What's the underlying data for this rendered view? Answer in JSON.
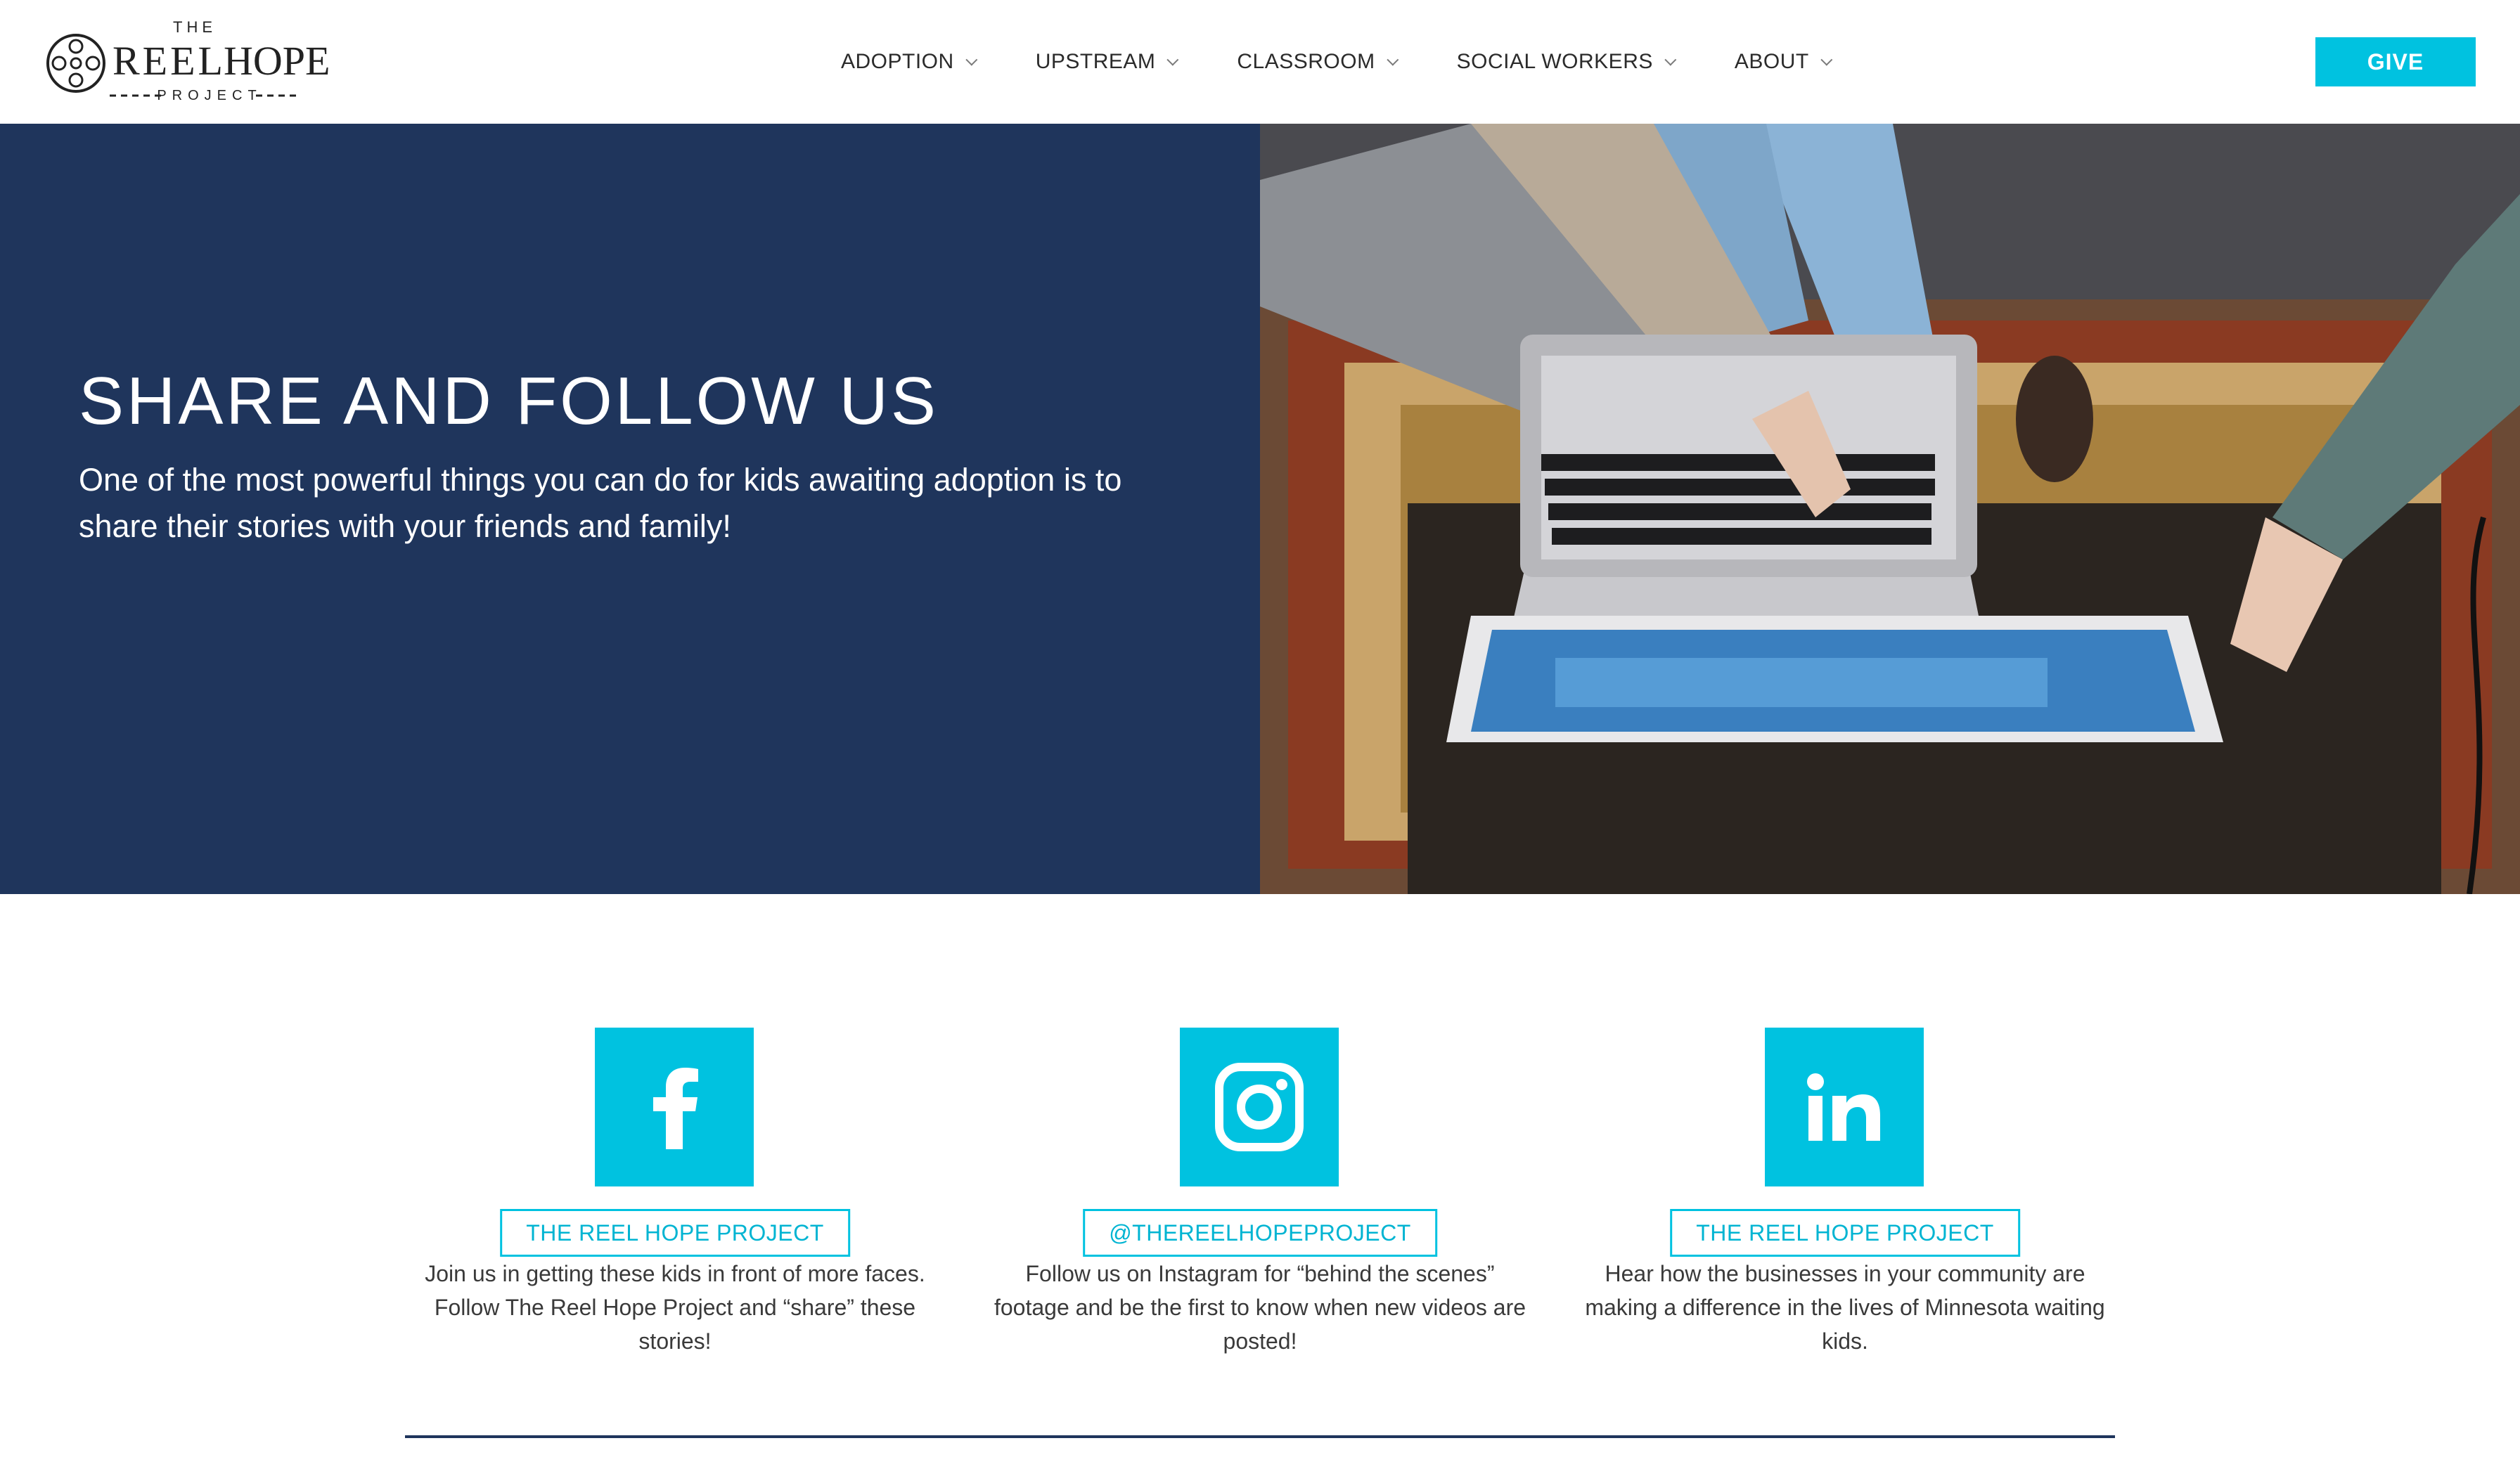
{
  "header": {
    "logo": {
      "top": "THE",
      "reel": "REEL",
      "hope": "HOPE",
      "bottom": "PROJECT"
    },
    "nav": [
      {
        "label": "ADOPTION"
      },
      {
        "label": "UPSTREAM"
      },
      {
        "label": "CLASSROOM"
      },
      {
        "label": "SOCIAL WORKERS"
      },
      {
        "label": "ABOUT"
      }
    ],
    "give_label": "GIVE"
  },
  "hero": {
    "title": "SHARE AND FOLLOW US",
    "subtitle": "One of the most powerful things you can do for kids awaiting adoption is to share their stories with your friends and family!"
  },
  "social": [
    {
      "icon": "facebook-icon",
      "handle": "THE REEL HOPE PROJECT",
      "description": "Join us in getting these kids in front of more faces. Follow The Reel Hope Project and “share” these stories!"
    },
    {
      "icon": "instagram-icon",
      "handle": "@THEREELHOPEPROJECT",
      "description": "Follow us on Instagram for “behind the scenes” footage and be the first to know when new videos are posted!"
    },
    {
      "icon": "linkedin-icon",
      "handle": "THE REEL HOPE PROJECT",
      "description": "Hear how the businesses in your community are making a difference in the lives of Minnesota waiting kids."
    }
  ],
  "colors": {
    "navy": "#1f355c",
    "accent": "#00c2e0"
  }
}
